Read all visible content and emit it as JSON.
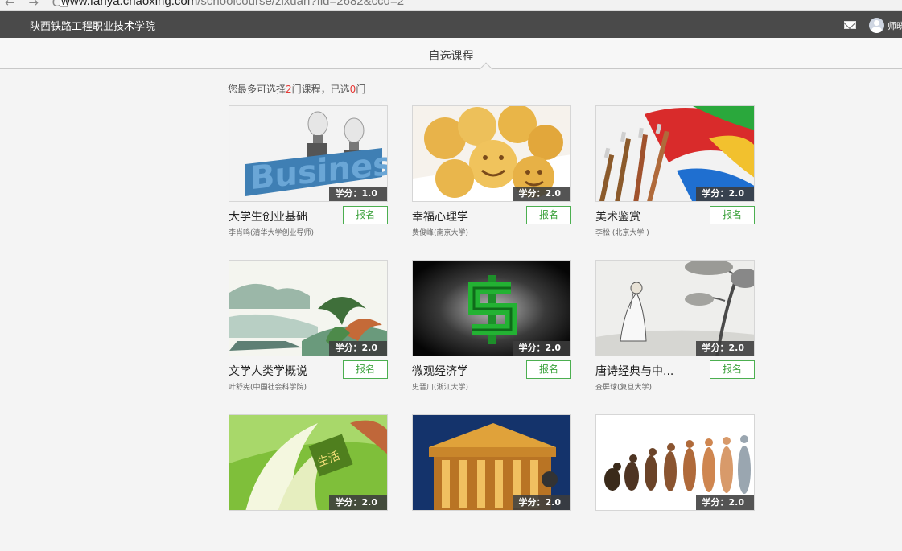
{
  "browser": {
    "nav_glyphs": "← → C",
    "url_host": "www.fanya.chaoxing.com",
    "url_path": "/schoolcourse/zixuan?fid=2682&ccd=2"
  },
  "topbar": {
    "school_name": "陕西铁路工程职业技术学院",
    "username": "师晓"
  },
  "subheader": {
    "title": "自选课程"
  },
  "limit": {
    "prefix": "您最多可选择",
    "max": "2",
    "middle": "门课程，已选",
    "selected": "0",
    "suffix": "门"
  },
  "enroll_label": "报名",
  "courses": [
    {
      "name": "大学生创业基础",
      "teacher": "李肖鸣(清华大学创业导师)",
      "credit": "学分：1.0"
    },
    {
      "name": "幸福心理学",
      "teacher": "费俊峰(南京大学)",
      "credit": "学分：2.0"
    },
    {
      "name": "美术鉴赏",
      "teacher": "李松 (北京大学 )",
      "credit": "学分：2.0"
    },
    {
      "name": "文学人类学概说",
      "teacher": "叶舒宪(中国社会科学院)",
      "credit": "学分：2.0"
    },
    {
      "name": "微观经济学",
      "teacher": "史晋川(浙江大学)",
      "credit": "学分：2.0"
    },
    {
      "name": "唐诗经典与中...",
      "teacher": "查屏球(复旦大学)",
      "credit": "学分：2.0"
    },
    {
      "name": "",
      "teacher": "",
      "credit": "学分：2.0"
    },
    {
      "name": "",
      "teacher": "",
      "credit": "学分：2.0"
    },
    {
      "name": "",
      "teacher": "",
      "credit": "学分：2.0"
    }
  ],
  "colors": {
    "topbar_bg": "#4a4a4a",
    "accent_red": "#e53935",
    "enroll_green": "#4caf50"
  }
}
